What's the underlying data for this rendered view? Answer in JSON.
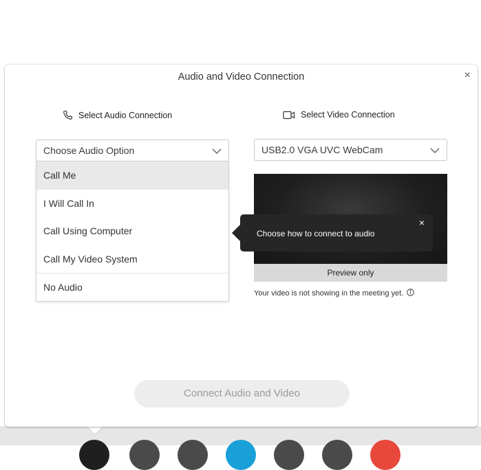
{
  "dialog": {
    "title": "Audio and Video Connection",
    "close_glyph": "×"
  },
  "audio": {
    "heading": "Select Audio Connection",
    "heading_icon": "phone-icon",
    "select_value": "Choose Audio Option",
    "options": [
      {
        "label": "Call Me",
        "selected": true
      },
      {
        "label": "I Will Call In",
        "selected": false
      },
      {
        "label": "Call Using Computer",
        "selected": false
      },
      {
        "label": "Call My Video System",
        "selected": false
      },
      {
        "label": "No Audio",
        "selected": false
      }
    ]
  },
  "video": {
    "heading": "Select Video Connection",
    "heading_icon": "video-camera-icon",
    "select_value": "USB2.0 VGA UVC WebCam",
    "preview_label": "Preview only",
    "note": "Your video is not showing in the meeting yet.",
    "note_icon": "info-icon"
  },
  "tooltip": {
    "text": "Choose how to connect to audio",
    "close_glyph": "×"
  },
  "connect_button": {
    "label": "Connect Audio and Video",
    "enabled": false
  },
  "colors": {
    "tooltip_bg": "#262626",
    "selected_item_bg": "#e9e9e9",
    "connect_btn_bg": "#ededed",
    "end_call_red": "#e8483b",
    "share_blue": "#1aa0d8"
  }
}
